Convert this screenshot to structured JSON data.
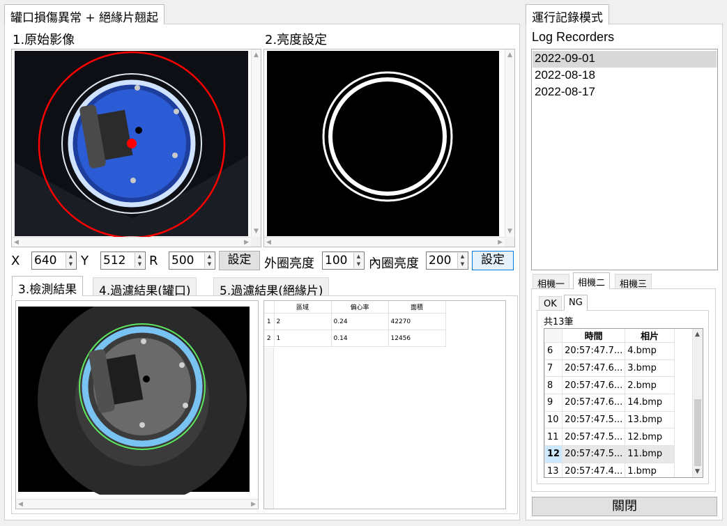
{
  "left_tabs": [
    {
      "label": "罐口損傷異常  +  絕緣片翹起",
      "active": true
    }
  ],
  "section1_title": "1.原始影像",
  "section2_title": "2.亮度設定",
  "controls": {
    "x_label": "X",
    "x_value": "640",
    "y_label": "Y",
    "y_value": "512",
    "r_label": "R",
    "r_value": "500",
    "set_button_1": "設定",
    "outer_label": "外圈亮度",
    "outer_value": "100",
    "inner_label": "內圈亮度",
    "inner_value": "200",
    "set_button_2": "設定"
  },
  "result_tabs": [
    {
      "label": "3.檢測結果",
      "active": true
    },
    {
      "label": "4.過濾結果(罐口)",
      "active": false
    },
    {
      "label": "5.過濾結果(絕緣片)",
      "active": false
    }
  ],
  "result_grid": {
    "headers": [
      "",
      "區域",
      "偏心率",
      "面積"
    ],
    "rows": [
      {
        "no": "1",
        "area": "2",
        "ecc": "0.24",
        "size": "42270"
      },
      {
        "no": "2",
        "area": "1",
        "ecc": "0.14",
        "size": "12456"
      }
    ]
  },
  "right_tab": "運行記錄模式",
  "log_title": "Log Recorders",
  "log_dates": [
    "2022-09-01",
    "2022-08-18",
    "2022-08-17"
  ],
  "camera_tabs": [
    {
      "label": "相機一",
      "active": false
    },
    {
      "label": "相機二",
      "active": true
    },
    {
      "label": "相機三",
      "active": false
    }
  ],
  "okng_tabs": [
    {
      "label": "OK",
      "active": false
    },
    {
      "label": "NG",
      "active": true
    }
  ],
  "total_label": "共13筆",
  "ng_headers": {
    "time": "時間",
    "photo": "相片"
  },
  "ng_rows": [
    {
      "no": "6",
      "time": "20:57:47.7...",
      "photo": "4.bmp"
    },
    {
      "no": "7",
      "time": "20:57:47.6...",
      "photo": "3.bmp"
    },
    {
      "no": "8",
      "time": "20:57:47.6...",
      "photo": "2.bmp"
    },
    {
      "no": "9",
      "time": "20:57:47.6...",
      "photo": "14.bmp"
    },
    {
      "no": "10",
      "time": "20:57:47.5...",
      "photo": "13.bmp"
    },
    {
      "no": "11",
      "time": "20:57:47.5...",
      "photo": "12.bmp"
    },
    {
      "no": "12",
      "time": "20:57:47.5...",
      "photo": "11.bmp",
      "selected": true
    },
    {
      "no": "13",
      "time": "20:57:47.4...",
      "photo": "1.bmp"
    }
  ],
  "close_button": "關閉",
  "colors": {
    "detect_circle": "#ff0000",
    "ring_blue": "#2c5bd6",
    "fit_green": "#5ee85e",
    "result_ring": "#79c3f2"
  }
}
